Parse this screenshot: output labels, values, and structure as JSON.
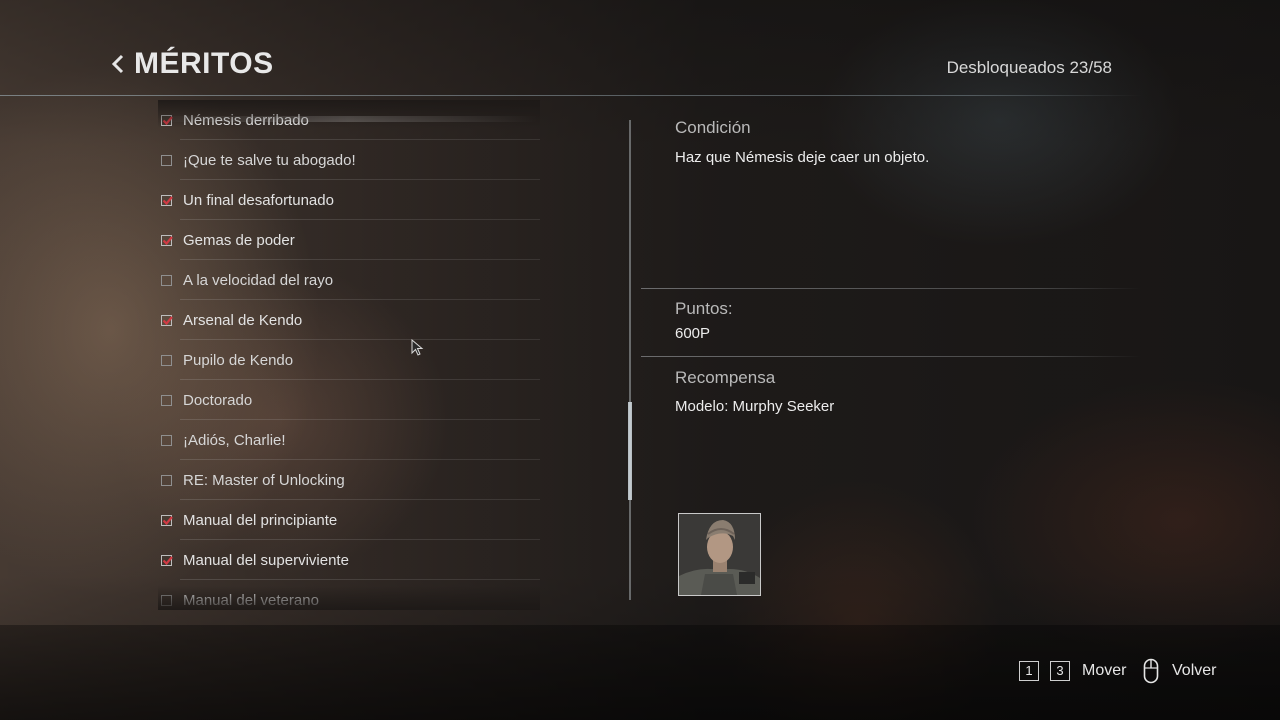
{
  "header": {
    "title": "MÉRITOS",
    "unlocked": "Desbloqueados 23/58"
  },
  "achievements": [
    {
      "label": "Némesis derribado",
      "checked": true
    },
    {
      "label": "¡Que te salve tu abogado!",
      "checked": false
    },
    {
      "label": "Un final desafortunado",
      "checked": true
    },
    {
      "label": "Gemas de poder",
      "checked": true
    },
    {
      "label": "A la velocidad del rayo",
      "checked": false
    },
    {
      "label": "Arsenal de Kendo",
      "checked": true
    },
    {
      "label": "Pupilo de Kendo",
      "checked": false
    },
    {
      "label": "Doctorado",
      "checked": false
    },
    {
      "label": "¡Adiós, Charlie!",
      "checked": false
    },
    {
      "label": "RE: Master of Unlocking",
      "checked": false
    },
    {
      "label": "Manual del principiante",
      "checked": true
    },
    {
      "label": "Manual del superviviente",
      "checked": true
    },
    {
      "label": "Manual del veterano",
      "checked": false
    }
  ],
  "detail": {
    "condition_label": "Condición",
    "condition_text": "Haz que Némesis deje caer un objeto.",
    "points_label": "Puntos:",
    "points_value": "600P",
    "reward_label": "Recompensa",
    "reward_value": "Modelo: Murphy Seeker"
  },
  "footer": {
    "key1": "1",
    "key2": "3",
    "move_label": "Mover",
    "back_label": "Volver"
  },
  "colors": {
    "check": "#d13a44",
    "text": "#e6e6e6"
  }
}
